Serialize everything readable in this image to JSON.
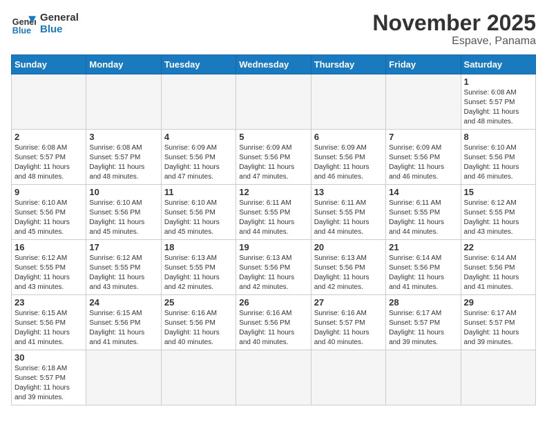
{
  "header": {
    "logo_general": "General",
    "logo_blue": "Blue",
    "month_title": "November 2025",
    "location": "Espave, Panama"
  },
  "days_of_week": [
    "Sunday",
    "Monday",
    "Tuesday",
    "Wednesday",
    "Thursday",
    "Friday",
    "Saturday"
  ],
  "weeks": [
    [
      {
        "day": "",
        "info": ""
      },
      {
        "day": "",
        "info": ""
      },
      {
        "day": "",
        "info": ""
      },
      {
        "day": "",
        "info": ""
      },
      {
        "day": "",
        "info": ""
      },
      {
        "day": "",
        "info": ""
      },
      {
        "day": "1",
        "info": "Sunrise: 6:08 AM\nSunset: 5:57 PM\nDaylight: 11 hours\nand 48 minutes."
      }
    ],
    [
      {
        "day": "2",
        "info": "Sunrise: 6:08 AM\nSunset: 5:57 PM\nDaylight: 11 hours\nand 48 minutes."
      },
      {
        "day": "3",
        "info": "Sunrise: 6:08 AM\nSunset: 5:57 PM\nDaylight: 11 hours\nand 48 minutes."
      },
      {
        "day": "4",
        "info": "Sunrise: 6:09 AM\nSunset: 5:56 PM\nDaylight: 11 hours\nand 47 minutes."
      },
      {
        "day": "5",
        "info": "Sunrise: 6:09 AM\nSunset: 5:56 PM\nDaylight: 11 hours\nand 47 minutes."
      },
      {
        "day": "6",
        "info": "Sunrise: 6:09 AM\nSunset: 5:56 PM\nDaylight: 11 hours\nand 46 minutes."
      },
      {
        "day": "7",
        "info": "Sunrise: 6:09 AM\nSunset: 5:56 PM\nDaylight: 11 hours\nand 46 minutes."
      },
      {
        "day": "8",
        "info": "Sunrise: 6:10 AM\nSunset: 5:56 PM\nDaylight: 11 hours\nand 46 minutes."
      }
    ],
    [
      {
        "day": "9",
        "info": "Sunrise: 6:10 AM\nSunset: 5:56 PM\nDaylight: 11 hours\nand 45 minutes."
      },
      {
        "day": "10",
        "info": "Sunrise: 6:10 AM\nSunset: 5:56 PM\nDaylight: 11 hours\nand 45 minutes."
      },
      {
        "day": "11",
        "info": "Sunrise: 6:10 AM\nSunset: 5:56 PM\nDaylight: 11 hours\nand 45 minutes."
      },
      {
        "day": "12",
        "info": "Sunrise: 6:11 AM\nSunset: 5:55 PM\nDaylight: 11 hours\nand 44 minutes."
      },
      {
        "day": "13",
        "info": "Sunrise: 6:11 AM\nSunset: 5:55 PM\nDaylight: 11 hours\nand 44 minutes."
      },
      {
        "day": "14",
        "info": "Sunrise: 6:11 AM\nSunset: 5:55 PM\nDaylight: 11 hours\nand 44 minutes."
      },
      {
        "day": "15",
        "info": "Sunrise: 6:12 AM\nSunset: 5:55 PM\nDaylight: 11 hours\nand 43 minutes."
      }
    ],
    [
      {
        "day": "16",
        "info": "Sunrise: 6:12 AM\nSunset: 5:55 PM\nDaylight: 11 hours\nand 43 minutes."
      },
      {
        "day": "17",
        "info": "Sunrise: 6:12 AM\nSunset: 5:55 PM\nDaylight: 11 hours\nand 43 minutes."
      },
      {
        "day": "18",
        "info": "Sunrise: 6:13 AM\nSunset: 5:55 PM\nDaylight: 11 hours\nand 42 minutes."
      },
      {
        "day": "19",
        "info": "Sunrise: 6:13 AM\nSunset: 5:56 PM\nDaylight: 11 hours\nand 42 minutes."
      },
      {
        "day": "20",
        "info": "Sunrise: 6:13 AM\nSunset: 5:56 PM\nDaylight: 11 hours\nand 42 minutes."
      },
      {
        "day": "21",
        "info": "Sunrise: 6:14 AM\nSunset: 5:56 PM\nDaylight: 11 hours\nand 41 minutes."
      },
      {
        "day": "22",
        "info": "Sunrise: 6:14 AM\nSunset: 5:56 PM\nDaylight: 11 hours\nand 41 minutes."
      }
    ],
    [
      {
        "day": "23",
        "info": "Sunrise: 6:15 AM\nSunset: 5:56 PM\nDaylight: 11 hours\nand 41 minutes."
      },
      {
        "day": "24",
        "info": "Sunrise: 6:15 AM\nSunset: 5:56 PM\nDaylight: 11 hours\nand 41 minutes."
      },
      {
        "day": "25",
        "info": "Sunrise: 6:16 AM\nSunset: 5:56 PM\nDaylight: 11 hours\nand 40 minutes."
      },
      {
        "day": "26",
        "info": "Sunrise: 6:16 AM\nSunset: 5:56 PM\nDaylight: 11 hours\nand 40 minutes."
      },
      {
        "day": "27",
        "info": "Sunrise: 6:16 AM\nSunset: 5:57 PM\nDaylight: 11 hours\nand 40 minutes."
      },
      {
        "day": "28",
        "info": "Sunrise: 6:17 AM\nSunset: 5:57 PM\nDaylight: 11 hours\nand 39 minutes."
      },
      {
        "day": "29",
        "info": "Sunrise: 6:17 AM\nSunset: 5:57 PM\nDaylight: 11 hours\nand 39 minutes."
      }
    ],
    [
      {
        "day": "30",
        "info": "Sunrise: 6:18 AM\nSunset: 5:57 PM\nDaylight: 11 hours\nand 39 minutes."
      },
      {
        "day": "",
        "info": ""
      },
      {
        "day": "",
        "info": ""
      },
      {
        "day": "",
        "info": ""
      },
      {
        "day": "",
        "info": ""
      },
      {
        "day": "",
        "info": ""
      },
      {
        "day": "",
        "info": ""
      }
    ]
  ]
}
